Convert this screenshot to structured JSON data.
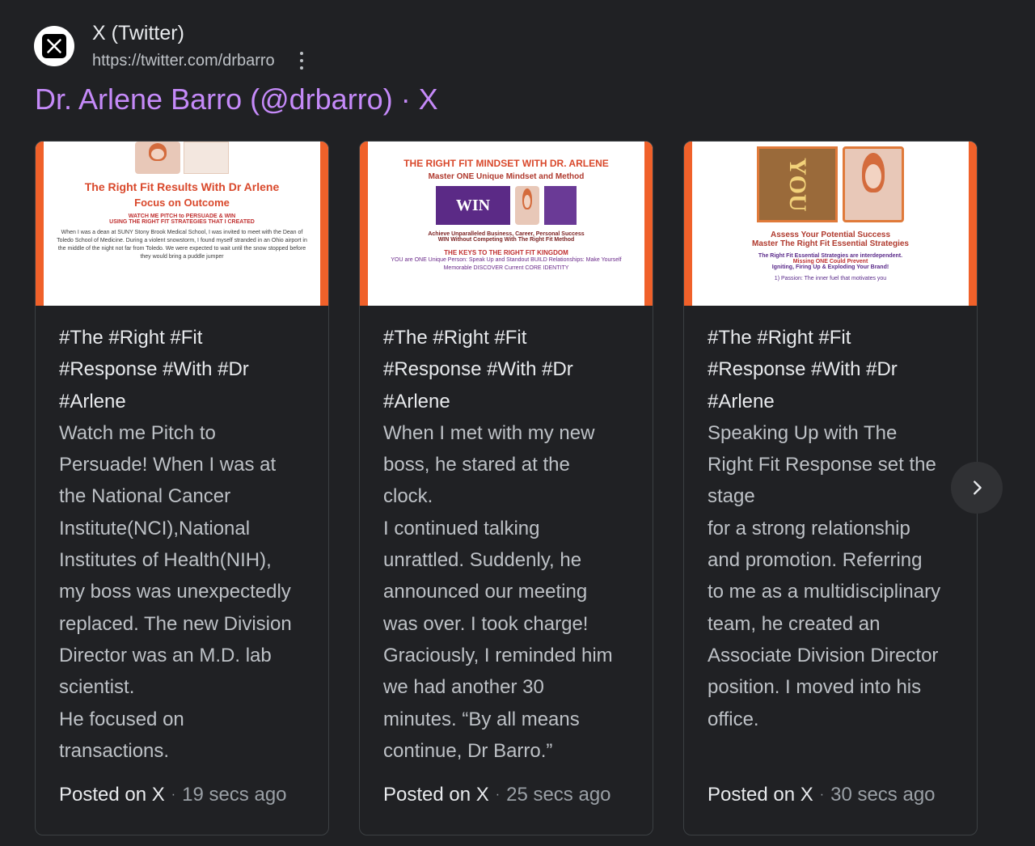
{
  "source": {
    "name": "X (Twitter)",
    "url": "https://twitter.com/drbarro"
  },
  "title": "Dr. Arlene Barro (@drbarro) · X",
  "cards": [
    {
      "tags": "#The #Right #Fit\n#Response #With #Dr\n#Arlene",
      "text": "Watch me Pitch to\nPersuade! When I was at\nthe National Cancer\nInstitute(NCI),National\nInstitutes of Health(NIH),\nmy boss was unexpectedly\nreplaced. The new Division\nDirector was an M.D. lab\nscientist.\nHe focused on\ntransactions.",
      "posted_label": "Posted on X",
      "time": "19 secs ago",
      "thumb": {
        "heading": "The Right Fit Results With Dr Arlene",
        "sub": "Focus on Outcome",
        "line1": "WATCH ME PITCH to PERSUADE & WIN",
        "line2": "USING THE RIGHT FIT STRATEGIES THAT I CREATED",
        "body": "When I was a dean at SUNY Stony Brook Medical School, I was invited to meet with the Dean of Toledo School of Medicine. During a violent snowstorm, I found myself stranded in an Ohio airport in the middle of the night not far from Toledo. We were expected to wait until the snow stopped before they would bring a puddle jumper"
      }
    },
    {
      "tags": "#The #Right #Fit\n#Response #With #Dr\n#Arlene",
      "text": "When I met with my new\nboss, he stared at the\nclock.\nI continued talking\nunrattled. Suddenly, he\nannounced our meeting\nwas over. I took charge!\nGraciously, I reminded him\nwe had another 30\nminutes. “By all means\ncontinue, Dr Barro.”",
      "posted_label": "Posted on X",
      "time": "25 secs ago",
      "thumb": {
        "heading": "THE RIGHT FIT MINDSET WITH DR. ARLENE",
        "sub": "Master ONE Unique Mindset and Method",
        "win": "WIN",
        "line1": "Achieve Unparalleled Business, Career, Personal Success",
        "line2": "WIN Without Competing With The Right Fit Method",
        "line3": "THE KEYS TO THE RIGHT FIT KINGDOM",
        "body": "YOU are ONE Unique Person: Speak Up and Standout BUILD Relationships: Make Yourself Memorable DISCOVER Current CORE IDENTITY"
      }
    },
    {
      "tags": "#The #Right #Fit\n#Response #With #Dr\n#Arlene",
      "text": "Speaking Up with The\nRight Fit Response set the\nstage\nfor a strong relationship\nand promotion. Referring\nto me as a multidisciplinary\nteam, he created an\nAssociate Division Director\nposition. I moved into his\noffice.",
      "posted_label": "Posted on X",
      "time": "30 secs ago",
      "thumb": {
        "you": "YOU",
        "heading": "Assess Your Potential Success",
        "sub": "Master The Right Fit Essential Strategies",
        "line1": "The Right Fit Essential Strategies are interdependent.",
        "line2": "Missing ONE Could Prevent",
        "line3": "Igniting, Firing Up & Exploding Your Brand!",
        "body": "1) Passion: The inner fuel that motivates you"
      }
    }
  ],
  "colors": {
    "background": "#202124",
    "title_link": "#c58af9",
    "thumb_border": "#f0612a"
  }
}
